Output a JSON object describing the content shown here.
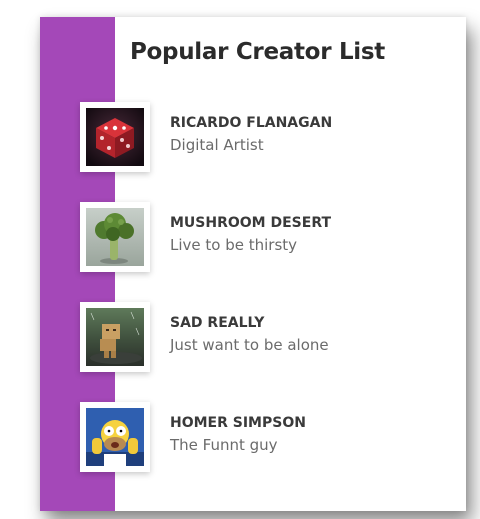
{
  "title": "Popular Creator List",
  "colors": {
    "accent": "#a448b8",
    "title_text": "#2b2b2b",
    "name_text": "#3a3a3a",
    "role_text": "#6b6b6b"
  },
  "creators": [
    {
      "name": "RICARDO FLANAGAN",
      "role": "Digital Artist",
      "avatar": "red-dice-image"
    },
    {
      "name": "MUSHROOM DESERT",
      "role": "Live to be thirsty",
      "avatar": "broccoli-image"
    },
    {
      "name": "SAD REALLY",
      "role": "Just want to be alone",
      "avatar": "cardboard-robot-image"
    },
    {
      "name": "HOMER SIMPSON",
      "role": "The Funnt guy",
      "avatar": "homer-cartoon-image"
    }
  ]
}
